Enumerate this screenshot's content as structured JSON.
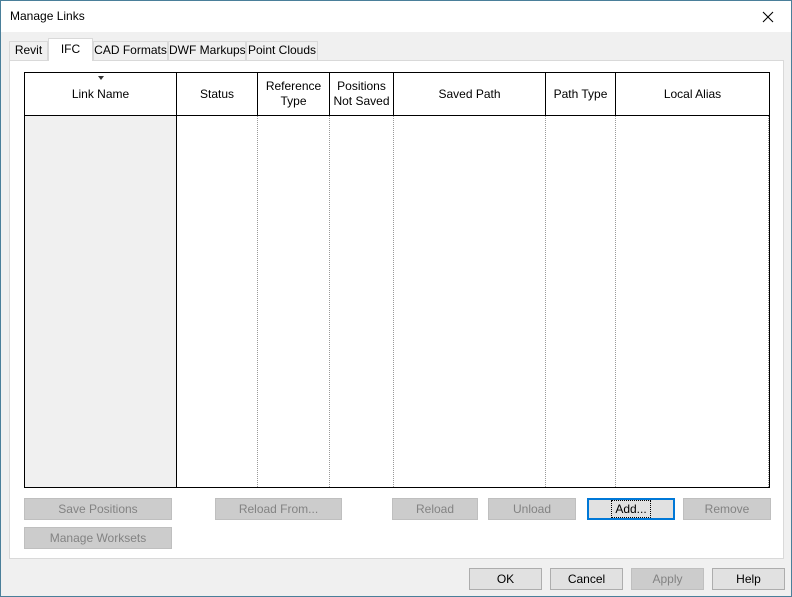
{
  "window": {
    "title": "Manage Links"
  },
  "tabs": [
    {
      "label": "Revit",
      "active": false
    },
    {
      "label": "IFC",
      "active": true
    },
    {
      "label": "CAD Formats",
      "active": false
    },
    {
      "label": "DWF Markups",
      "active": false
    },
    {
      "label": "Point Clouds",
      "active": false
    }
  ],
  "grid": {
    "sorted_column": "Link Name",
    "columns": [
      {
        "label": "Link Name"
      },
      {
        "label": "Status"
      },
      {
        "label": "Reference Type"
      },
      {
        "label": "Positions Not Saved"
      },
      {
        "label": "Saved Path"
      },
      {
        "label": "Path Type"
      },
      {
        "label": "Local Alias"
      }
    ],
    "rows": []
  },
  "actions": {
    "save_positions": {
      "label": "Save Positions",
      "enabled": false
    },
    "reload_from": {
      "label": "Reload From...",
      "enabled": false
    },
    "reload": {
      "label": "Reload",
      "enabled": false
    },
    "unload": {
      "label": "Unload",
      "enabled": false
    },
    "add": {
      "label": "Add...",
      "enabled": true
    },
    "remove": {
      "label": "Remove",
      "enabled": false
    },
    "manage_worksets": {
      "label": "Manage Worksets",
      "enabled": false
    }
  },
  "footer": {
    "ok": {
      "label": "OK",
      "enabled": true
    },
    "cancel": {
      "label": "Cancel",
      "enabled": true
    },
    "apply": {
      "label": "Apply",
      "enabled": false
    },
    "help": {
      "label": "Help",
      "enabled": true
    }
  },
  "colors": {
    "window_border": "#4a7f9a",
    "focus_accent": "#0078d7",
    "disabled_text": "#838383"
  }
}
